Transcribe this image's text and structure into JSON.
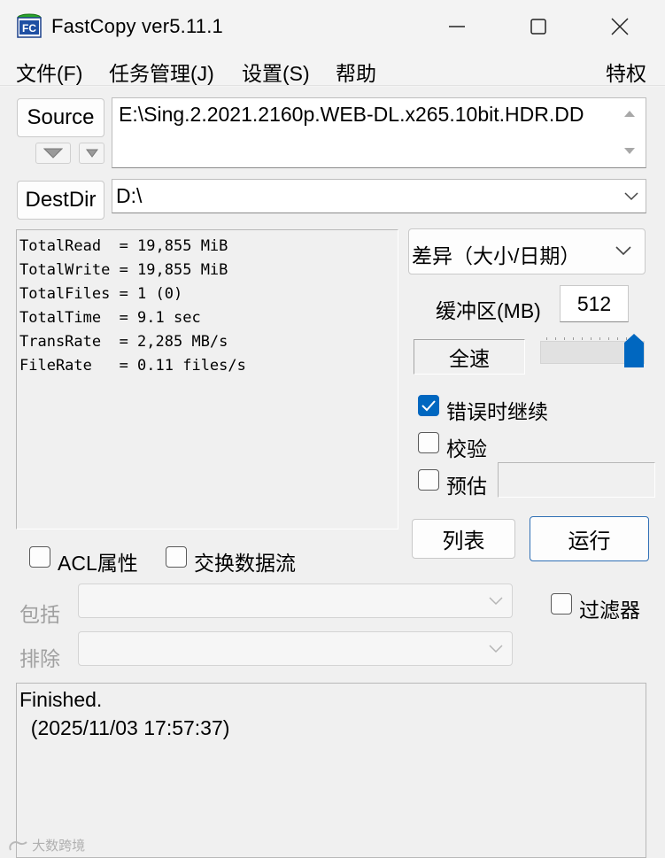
{
  "window": {
    "title": "FastCopy ver5.11.1",
    "app_icon_text": "FC"
  },
  "menu": {
    "file": "文件(F)",
    "task": "任务管理(J)",
    "settings": "设置(S)",
    "help": "帮助",
    "special": "特权"
  },
  "source": {
    "button_label": "Source",
    "path": "E:\\Sing.2.2021.2160p.WEB-DL.x265.10bit.HDR.DD"
  },
  "dest": {
    "button_label": "DestDir",
    "path": "D:\\"
  },
  "stats": [
    "TotalRead  = 19,855 MiB",
    "TotalWrite = 19,855 MiB",
    "TotalFiles = 1 (0)",
    "TotalTime  = 9.1 sec",
    "TransRate  = 2,285 MB/s",
    "FileRate   = 0.11 files/s"
  ],
  "options": {
    "mode_selected": "差异（大小/日期）",
    "buffer_label": "缓冲区(MB)",
    "buffer_value": "512",
    "speed_label": "全速",
    "speed_level": 1.0,
    "continue_on_error": {
      "label": "错误时继续",
      "checked": true
    },
    "verify": {
      "label": "校验",
      "checked": false
    },
    "estimate": {
      "label": "预估",
      "checked": false
    }
  },
  "actions": {
    "list_label": "列表",
    "execute_label": "运行"
  },
  "stream_options": {
    "acl": {
      "label": "ACL属性",
      "checked": false
    },
    "alt_stream": {
      "label": "交换数据流",
      "checked": false
    },
    "filter": {
      "label": "过滤器",
      "checked": false
    }
  },
  "filters": {
    "include_label": "包括",
    "exclude_label": "排除"
  },
  "log": {
    "line1": "Finished.",
    "line2": "  (2025/11/03 17:57:37)"
  },
  "watermark": "大数跨境",
  "colors": {
    "accent": "#0067c0",
    "primary_border": "#2f6fb5",
    "background": "#f0f0f0"
  }
}
